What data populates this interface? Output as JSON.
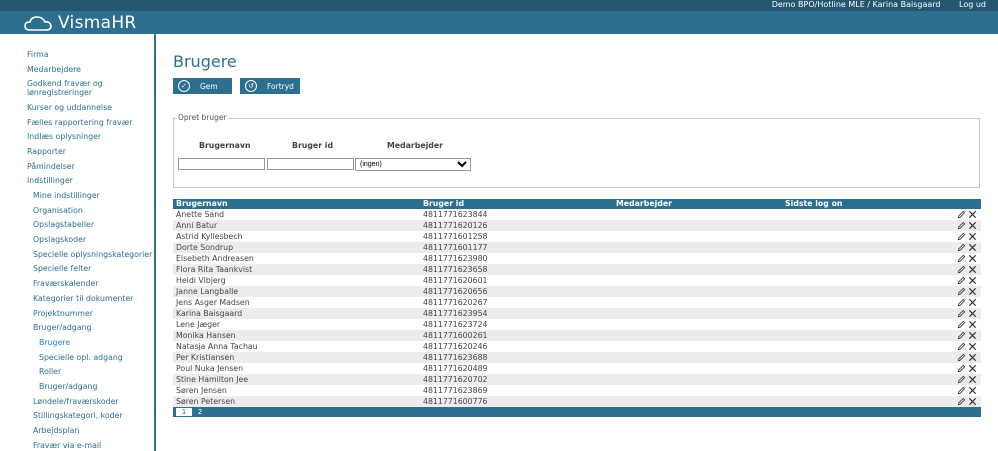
{
  "header": {
    "logo_text": "VismaHR",
    "user_label": "Demo BPO/Hotline MLE / Karina Baisgaard",
    "logout_label": "Log ud"
  },
  "sidebar": {
    "items": [
      {
        "label": "Firma",
        "level": 0
      },
      {
        "label": "Medarbejdere",
        "level": 0
      },
      {
        "label": "Godkend fravær og lønregistreringer",
        "level": 0
      },
      {
        "label": "Kurser og uddannelse",
        "level": 0
      },
      {
        "label": "Fælles rapportering fravær",
        "level": 0
      },
      {
        "label": "Indlæs oplysninger",
        "level": 0
      },
      {
        "label": "Rapporter",
        "level": 0
      },
      {
        "label": "Påmindelser",
        "level": 0
      },
      {
        "label": "Indstillinger",
        "level": 0
      },
      {
        "label": "Mine indstillinger",
        "level": 1
      },
      {
        "label": "Organisation",
        "level": 1
      },
      {
        "label": "Opslagstabeller",
        "level": 1
      },
      {
        "label": "Opslagskoder",
        "level": 1
      },
      {
        "label": "Specielle oplysningskategorier",
        "level": 1
      },
      {
        "label": "Specielle felter",
        "level": 1
      },
      {
        "label": "Fraværskalender",
        "level": 1
      },
      {
        "label": "Kategorier til dokumenter",
        "level": 1
      },
      {
        "label": "Projektnummer",
        "level": 1
      },
      {
        "label": "Bruger/adgang",
        "level": 1
      },
      {
        "label": "Brugere",
        "level": 2,
        "active": true
      },
      {
        "label": "Specielle opl. adgang",
        "level": 2
      },
      {
        "label": "Roller",
        "level": 2
      },
      {
        "label": "Bruger/adgang",
        "level": 2
      },
      {
        "label": "Løndele/fraværskoder",
        "level": 1
      },
      {
        "label": "Stillingskategori, koder",
        "level": 1
      },
      {
        "label": "Arbejdsplan",
        "level": 1
      },
      {
        "label": "Fravær via e-mail",
        "level": 1
      }
    ]
  },
  "page": {
    "title": "Brugere",
    "save_label": "Gem",
    "cancel_label": "Fortryd"
  },
  "create_user": {
    "legend": "Opret bruger",
    "col_username": "Brugernavn",
    "col_userid": "Bruger id",
    "col_employee": "Medarbejder",
    "username_value": "",
    "userid_value": "",
    "employee_selected": "(ingen)"
  },
  "table": {
    "headers": [
      "Brugernavn",
      "Bruger id",
      "Medarbejder",
      "Sidste log on"
    ],
    "rows": [
      {
        "name": "Anette Sand",
        "id": "4811771623844",
        "employee": "",
        "last_logon": ""
      },
      {
        "name": "Anni Batur",
        "id": "4811771620126",
        "employee": "",
        "last_logon": ""
      },
      {
        "name": "Astrid Kyllesbech",
        "id": "4811771601258",
        "employee": "",
        "last_logon": ""
      },
      {
        "name": "Dorte Sondrup",
        "id": "4811771601177",
        "employee": "",
        "last_logon": ""
      },
      {
        "name": "Elsebeth Andreasen",
        "id": "4811771623980",
        "employee": "",
        "last_logon": ""
      },
      {
        "name": "Flora Rita Taankvist",
        "id": "4811771623658",
        "employee": "",
        "last_logon": ""
      },
      {
        "name": "Heidi Vibjerg",
        "id": "4811771620601",
        "employee": "",
        "last_logon": ""
      },
      {
        "name": "Janne Langballe",
        "id": "4811771620656",
        "employee": "",
        "last_logon": ""
      },
      {
        "name": "Jens Asger Madsen",
        "id": "4811771620267",
        "employee": "",
        "last_logon": ""
      },
      {
        "name": "Karina Baisgaard",
        "id": "4811771623954",
        "employee": "",
        "last_logon": ""
      },
      {
        "name": "Lene Jæger",
        "id": "4811771623724",
        "employee": "",
        "last_logon": ""
      },
      {
        "name": "Monika Hansen",
        "id": "4811771600261",
        "employee": "",
        "last_logon": ""
      },
      {
        "name": "Natasja Anna Tachau",
        "id": "4811771620246",
        "employee": "",
        "last_logon": ""
      },
      {
        "name": "Per Kristiansen",
        "id": "4811771623688",
        "employee": "",
        "last_logon": ""
      },
      {
        "name": "Poul Nuka Jensen",
        "id": "4811771620489",
        "employee": "",
        "last_logon": ""
      },
      {
        "name": "Stine Hamilton Jee",
        "id": "4811771620702",
        "employee": "",
        "last_logon": ""
      },
      {
        "name": "Søren Jensen",
        "id": "4811771623869",
        "employee": "",
        "last_logon": ""
      },
      {
        "name": "Søren Petersen",
        "id": "4811771600776",
        "employee": "",
        "last_logon": ""
      }
    ],
    "pages": [
      "1",
      "2"
    ],
    "current_page": "1"
  },
  "colors": {
    "brand": "#2d6f8e",
    "top_strip": "#255670",
    "link": "#2d6f8e",
    "active_link": "#1d7fd6",
    "row_alt": "#ececec"
  },
  "icons": {
    "save": "check-circle-icon",
    "cancel": "undo-circle-icon",
    "edit": "pencil-icon",
    "delete": "close-icon"
  }
}
